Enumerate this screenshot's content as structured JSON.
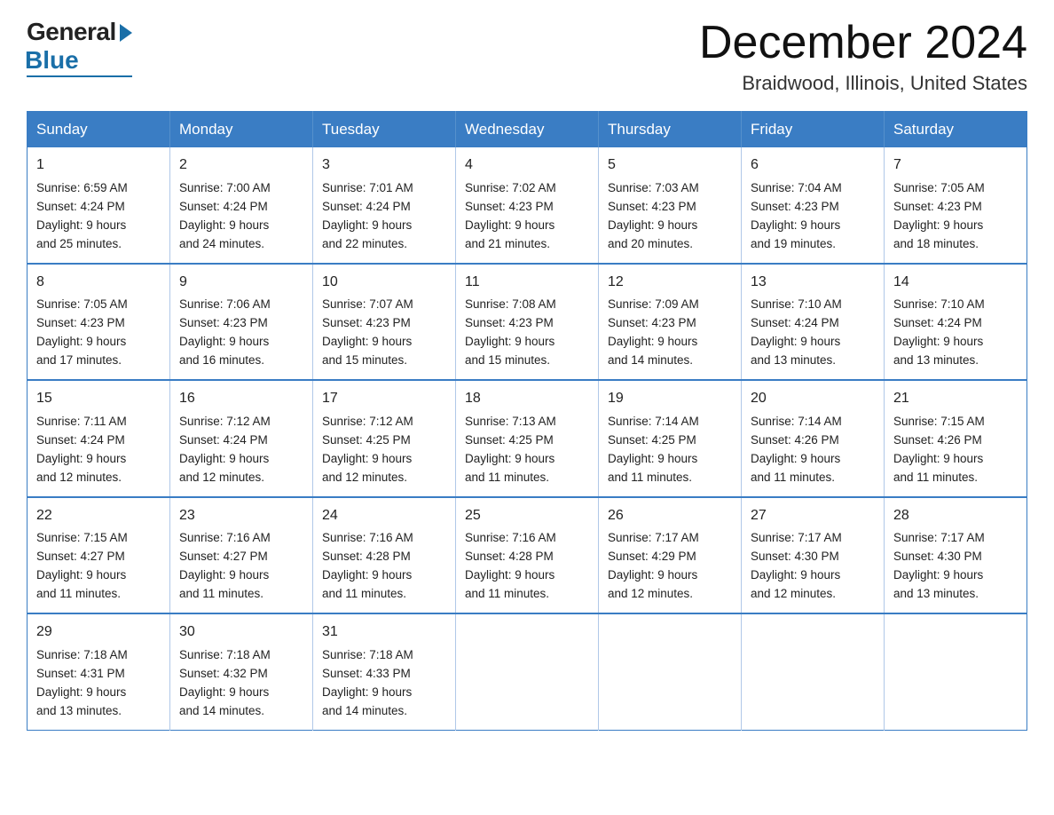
{
  "header": {
    "logo_general": "General",
    "logo_blue": "Blue",
    "month_title": "December 2024",
    "location": "Braidwood, Illinois, United States"
  },
  "weekdays": [
    "Sunday",
    "Monday",
    "Tuesday",
    "Wednesday",
    "Thursday",
    "Friday",
    "Saturday"
  ],
  "weeks": [
    [
      {
        "day": "1",
        "sunrise": "6:59 AM",
        "sunset": "4:24 PM",
        "daylight": "9 hours and 25 minutes."
      },
      {
        "day": "2",
        "sunrise": "7:00 AM",
        "sunset": "4:24 PM",
        "daylight": "9 hours and 24 minutes."
      },
      {
        "day": "3",
        "sunrise": "7:01 AM",
        "sunset": "4:24 PM",
        "daylight": "9 hours and 22 minutes."
      },
      {
        "day": "4",
        "sunrise": "7:02 AM",
        "sunset": "4:23 PM",
        "daylight": "9 hours and 21 minutes."
      },
      {
        "day": "5",
        "sunrise": "7:03 AM",
        "sunset": "4:23 PM",
        "daylight": "9 hours and 20 minutes."
      },
      {
        "day": "6",
        "sunrise": "7:04 AM",
        "sunset": "4:23 PM",
        "daylight": "9 hours and 19 minutes."
      },
      {
        "day": "7",
        "sunrise": "7:05 AM",
        "sunset": "4:23 PM",
        "daylight": "9 hours and 18 minutes."
      }
    ],
    [
      {
        "day": "8",
        "sunrise": "7:05 AM",
        "sunset": "4:23 PM",
        "daylight": "9 hours and 17 minutes."
      },
      {
        "day": "9",
        "sunrise": "7:06 AM",
        "sunset": "4:23 PM",
        "daylight": "9 hours and 16 minutes."
      },
      {
        "day": "10",
        "sunrise": "7:07 AM",
        "sunset": "4:23 PM",
        "daylight": "9 hours and 15 minutes."
      },
      {
        "day": "11",
        "sunrise": "7:08 AM",
        "sunset": "4:23 PM",
        "daylight": "9 hours and 15 minutes."
      },
      {
        "day": "12",
        "sunrise": "7:09 AM",
        "sunset": "4:23 PM",
        "daylight": "9 hours and 14 minutes."
      },
      {
        "day": "13",
        "sunrise": "7:10 AM",
        "sunset": "4:24 PM",
        "daylight": "9 hours and 13 minutes."
      },
      {
        "day": "14",
        "sunrise": "7:10 AM",
        "sunset": "4:24 PM",
        "daylight": "9 hours and 13 minutes."
      }
    ],
    [
      {
        "day": "15",
        "sunrise": "7:11 AM",
        "sunset": "4:24 PM",
        "daylight": "9 hours and 12 minutes."
      },
      {
        "day": "16",
        "sunrise": "7:12 AM",
        "sunset": "4:24 PM",
        "daylight": "9 hours and 12 minutes."
      },
      {
        "day": "17",
        "sunrise": "7:12 AM",
        "sunset": "4:25 PM",
        "daylight": "9 hours and 12 minutes."
      },
      {
        "day": "18",
        "sunrise": "7:13 AM",
        "sunset": "4:25 PM",
        "daylight": "9 hours and 11 minutes."
      },
      {
        "day": "19",
        "sunrise": "7:14 AM",
        "sunset": "4:25 PM",
        "daylight": "9 hours and 11 minutes."
      },
      {
        "day": "20",
        "sunrise": "7:14 AM",
        "sunset": "4:26 PM",
        "daylight": "9 hours and 11 minutes."
      },
      {
        "day": "21",
        "sunrise": "7:15 AM",
        "sunset": "4:26 PM",
        "daylight": "9 hours and 11 minutes."
      }
    ],
    [
      {
        "day": "22",
        "sunrise": "7:15 AM",
        "sunset": "4:27 PM",
        "daylight": "9 hours and 11 minutes."
      },
      {
        "day": "23",
        "sunrise": "7:16 AM",
        "sunset": "4:27 PM",
        "daylight": "9 hours and 11 minutes."
      },
      {
        "day": "24",
        "sunrise": "7:16 AM",
        "sunset": "4:28 PM",
        "daylight": "9 hours and 11 minutes."
      },
      {
        "day": "25",
        "sunrise": "7:16 AM",
        "sunset": "4:28 PM",
        "daylight": "9 hours and 11 minutes."
      },
      {
        "day": "26",
        "sunrise": "7:17 AM",
        "sunset": "4:29 PM",
        "daylight": "9 hours and 12 minutes."
      },
      {
        "day": "27",
        "sunrise": "7:17 AM",
        "sunset": "4:30 PM",
        "daylight": "9 hours and 12 minutes."
      },
      {
        "day": "28",
        "sunrise": "7:17 AM",
        "sunset": "4:30 PM",
        "daylight": "9 hours and 13 minutes."
      }
    ],
    [
      {
        "day": "29",
        "sunrise": "7:18 AM",
        "sunset": "4:31 PM",
        "daylight": "9 hours and 13 minutes."
      },
      {
        "day": "30",
        "sunrise": "7:18 AM",
        "sunset": "4:32 PM",
        "daylight": "9 hours and 14 minutes."
      },
      {
        "day": "31",
        "sunrise": "7:18 AM",
        "sunset": "4:33 PM",
        "daylight": "9 hours and 14 minutes."
      },
      null,
      null,
      null,
      null
    ]
  ],
  "labels": {
    "sunrise": "Sunrise:",
    "sunset": "Sunset:",
    "daylight": "Daylight:"
  }
}
